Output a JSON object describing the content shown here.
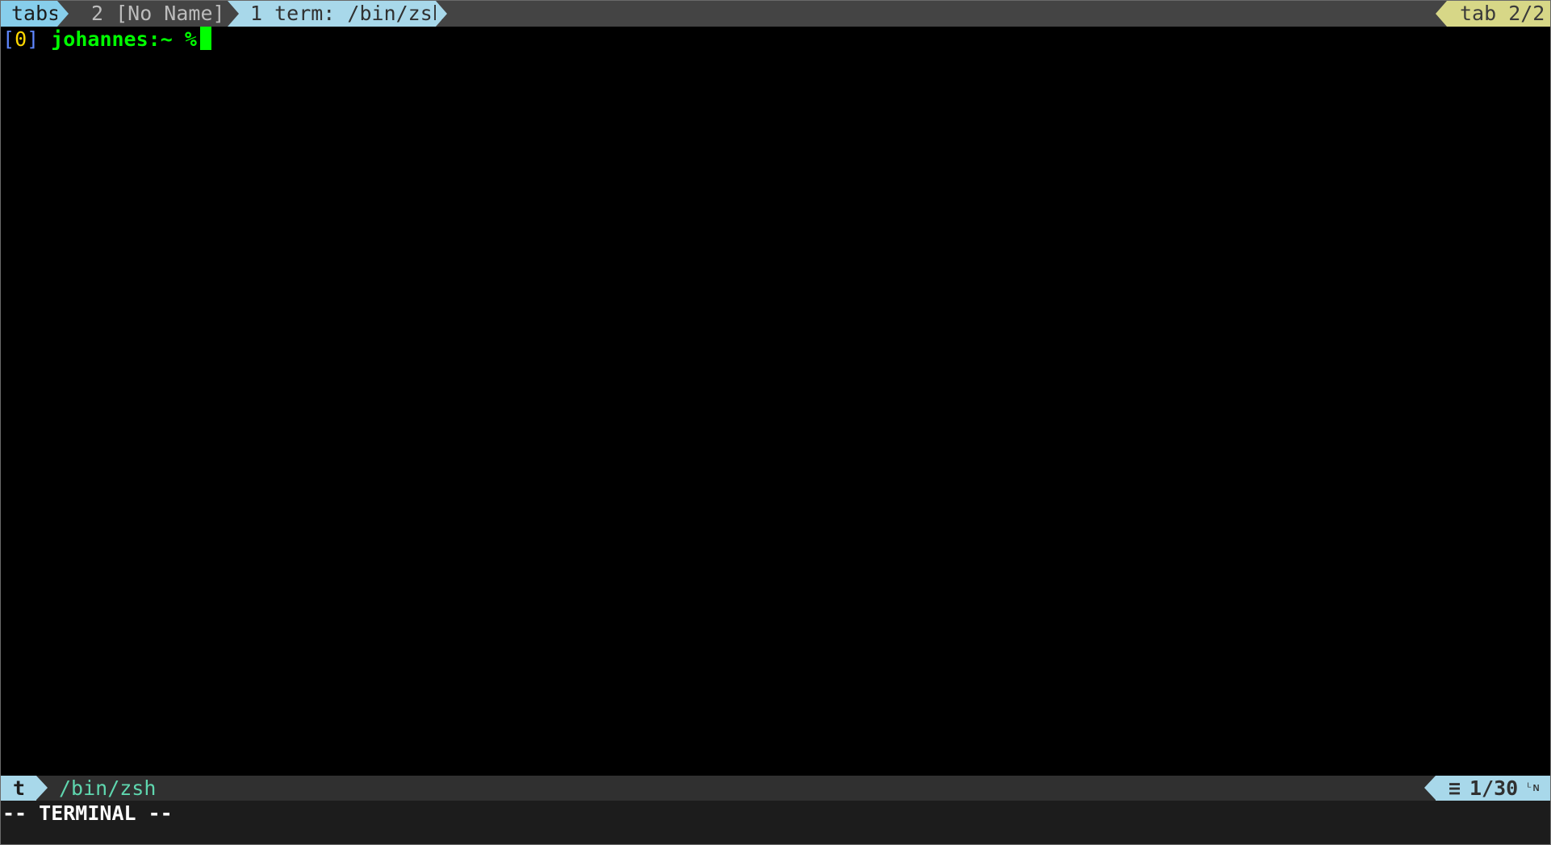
{
  "colors": {
    "accent_blue": "#87ceeb",
    "tab_inactive_bg": "#444444",
    "tab_active_bg": "#a8d8ea",
    "tab_count_bg": "#d7d787",
    "prompt_green": "#00ff00",
    "bracket_blue": "#5f87ff",
    "index_yellow": "#ffd700",
    "status_bg": "#303030",
    "path_teal": "#5fd7af"
  },
  "tabline": {
    "label": "tabs",
    "tabs": [
      {
        "label": "2 [No Name]",
        "active": false
      },
      {
        "label": "1 term: /bin/zsh",
        "active": true
      }
    ],
    "tab_count": "tab 2/2"
  },
  "terminal": {
    "bracket_open": "[",
    "index": "0",
    "bracket_close": "]",
    "prompt": "johannes:~ %"
  },
  "statusline": {
    "mode": "t",
    "path": "/bin/zsh",
    "position_icon": "≡",
    "position": "1/30",
    "line_indicator": "ᴸɴ"
  },
  "cmdline": {
    "text": "-- TERMINAL --"
  }
}
